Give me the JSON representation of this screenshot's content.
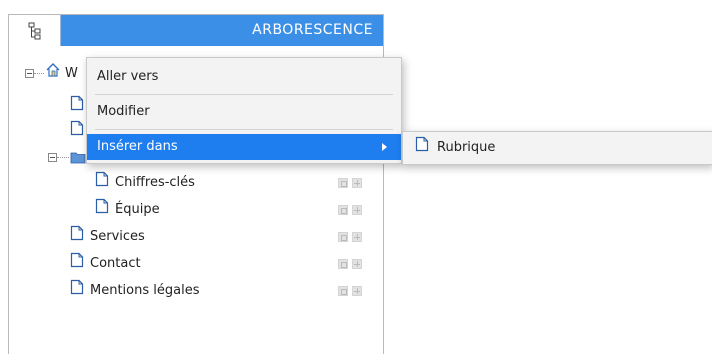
{
  "panel": {
    "title": "ARBORESCENCE",
    "header_color": "#3c8fe6",
    "header_icon": "tree-structure-icon"
  },
  "tree": {
    "root_label_visible": "W",
    "root_icon": "home-icon",
    "items": [
      {
        "label": "Chiffres-clés",
        "icon": "page-icon"
      },
      {
        "label": "Équipe",
        "icon": "page-icon"
      },
      {
        "label": "Services",
        "icon": "page-icon"
      },
      {
        "label": "Contact",
        "icon": "page-icon"
      },
      {
        "label": "Mentions légales",
        "icon": "page-icon"
      }
    ]
  },
  "context_menu": {
    "items": [
      {
        "label": "Aller vers"
      },
      {
        "label": "Modifier"
      },
      {
        "label": "Insérer dans",
        "has_submenu": true,
        "active": true
      }
    ],
    "active_color": "#1e7ef0"
  },
  "submenu": {
    "items": [
      {
        "label": "Rubrique",
        "icon": "page-icon"
      }
    ]
  }
}
